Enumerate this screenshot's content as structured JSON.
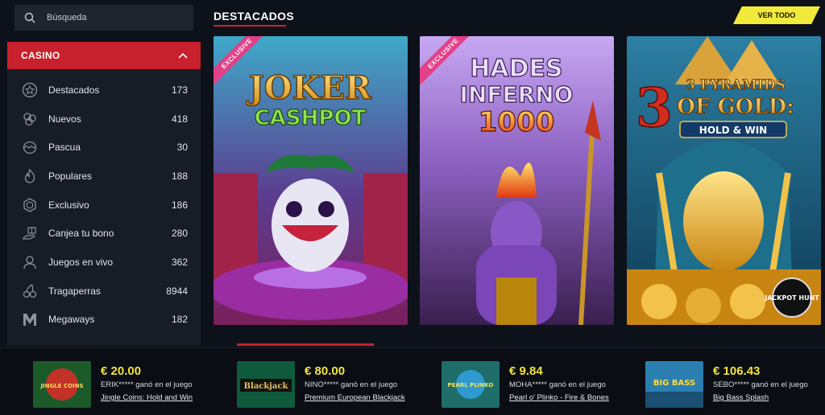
{
  "search": {
    "placeholder": "Búsqueda"
  },
  "casino": {
    "title": "CASINO"
  },
  "menu": [
    {
      "label": "Destacados",
      "count": "173",
      "icon": "star-badge-icon"
    },
    {
      "label": "Nuevos",
      "count": "418",
      "icon": "new-flower-icon"
    },
    {
      "label": "Pascua",
      "count": "30",
      "icon": "easter-egg-icon"
    },
    {
      "label": "Populares",
      "count": "188",
      "icon": "flame-icon"
    },
    {
      "label": "Exclusivo",
      "count": "186",
      "icon": "diamond-hex-icon"
    },
    {
      "label": "Canjea tu bono",
      "count": "280",
      "icon": "gift-hand-icon"
    },
    {
      "label": "Juegos en vivo",
      "count": "362",
      "icon": "live-dealer-icon"
    },
    {
      "label": "Tragaperras",
      "count": "8944",
      "icon": "cherries-icon"
    },
    {
      "label": "Megaways",
      "count": "182",
      "icon": "megaways-m-icon"
    }
  ],
  "section": {
    "title": "DESTACADOS",
    "ver_todo": "VER TODO"
  },
  "cards": [
    {
      "name": "Joker Cashpot",
      "title_line1": "JOKER",
      "title_line2": "CASHPOT",
      "badge": "EXCLUSIVE"
    },
    {
      "name": "Hades Inferno 1000",
      "title_line1": "HADES",
      "title_line2": "INFERNO",
      "title_line3": "1000",
      "badge": "EXCLUSIVE"
    },
    {
      "name": "3 Pyramids of Gold: Hold & Win",
      "title_line1": "3 PYRAMIDS",
      "title_line2": "OF GOLD:",
      "title_line3": "HOLD & WIN",
      "logo": "JACKPOT HUNT"
    }
  ],
  "winners": [
    {
      "amount": "€ 20.00",
      "user": "ERIK***** ganó en el juego",
      "game": "Jingle Coins: Hold and Win",
      "thumb_text": "JINGLE COINS"
    },
    {
      "amount": "€ 80.00",
      "user": "NINO***** ganó en el juego",
      "game": "Premium European Blackjack",
      "thumb_text": "Blackjack"
    },
    {
      "amount": "€ 9.84",
      "user": "MOHA***** ganó en el juego",
      "game": "Pearl o' Plinko - Fire & Bones",
      "thumb_text": "PEARL PLINKO"
    },
    {
      "amount": "€ 106.43",
      "user": "SEBO***** ganó en el juego",
      "game": "Big Bass Splash",
      "thumb_text": "BIG BASS"
    }
  ],
  "colors": {
    "accent_red": "#c8202c",
    "accent_yellow": "#f2ea3a",
    "panel": "#171c26",
    "background": "#0d111a"
  }
}
